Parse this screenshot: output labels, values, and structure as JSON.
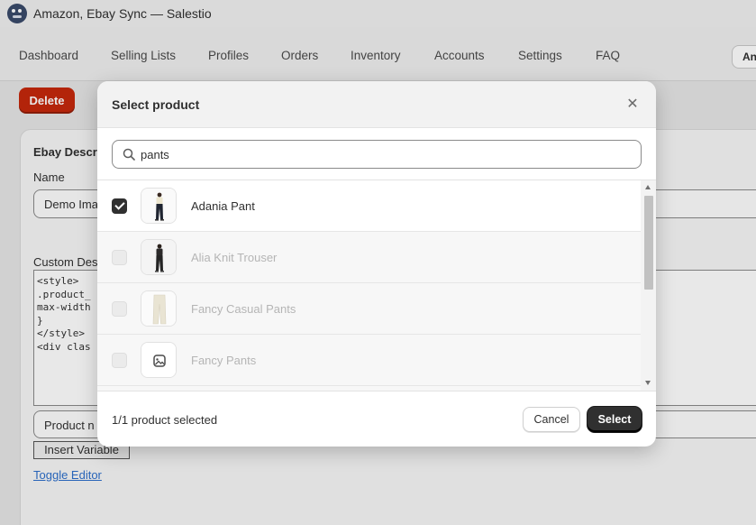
{
  "app": {
    "title": "Amazon, Ebay Sync — Salestio",
    "logo_icon": "salestio-logo-icon"
  },
  "nav": {
    "items": [
      {
        "label": "Dashboard"
      },
      {
        "label": "Selling Lists"
      },
      {
        "label": "Profiles"
      },
      {
        "label": "Orders"
      },
      {
        "label": "Inventory"
      },
      {
        "label": "Accounts"
      },
      {
        "label": "Settings"
      },
      {
        "label": "FAQ"
      }
    ],
    "right_button_label": "An"
  },
  "page": {
    "delete_label": "Delete",
    "card_title": "Ebay Descr",
    "name_label": "Name",
    "name_value": "Demo Ima",
    "custom_desc_label": "Custom Des",
    "code_lines": [
      "<style>",
      ".product_",
      "max-width",
      "}",
      "</style>",
      "<div clas"
    ],
    "product_field_value": "Product n",
    "insert_variable_label": "Insert Variable",
    "toggle_editor_label": "Toggle Editor"
  },
  "modal": {
    "title": "Select product",
    "close_icon": "close-icon",
    "search": {
      "value": "pants",
      "icon": "search-icon"
    },
    "products": [
      {
        "name": "Adania Pant",
        "checked": true,
        "disabled": false
      },
      {
        "name": "Alia Knit Trouser",
        "checked": false,
        "disabled": true
      },
      {
        "name": "Fancy Casual Pants",
        "checked": false,
        "disabled": true
      },
      {
        "name": "Fancy Pants",
        "checked": false,
        "disabled": true
      }
    ],
    "selected_count_text": "1/1 product selected",
    "cancel_label": "Cancel",
    "select_label": "Select"
  },
  "colors": {
    "delete_bg": "#c5280c",
    "primary_bg": "#303030",
    "link": "#2c6ecb"
  }
}
